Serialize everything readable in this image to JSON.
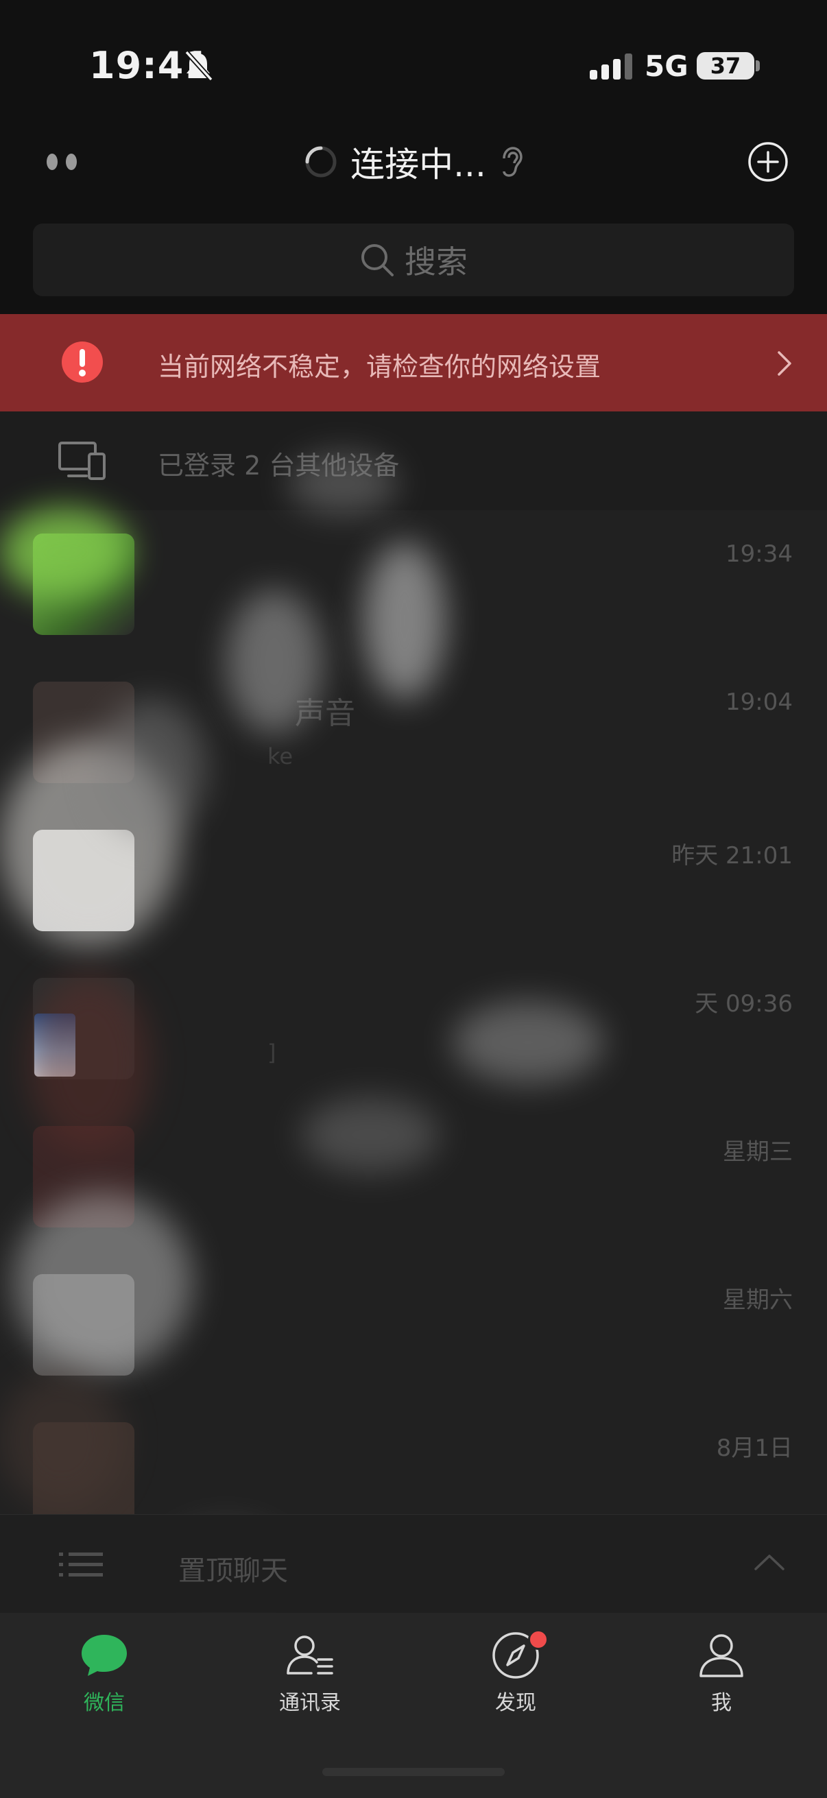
{
  "status_bar": {
    "time": "19:41",
    "network": "5G",
    "battery": "37"
  },
  "nav": {
    "title": "连接中..."
  },
  "search": {
    "placeholder": "搜索"
  },
  "alert": {
    "text": "当前网络不稳定，请检查你的网络设置",
    "color": "#862a2b"
  },
  "device": {
    "text": "已登录 2 台其他设备"
  },
  "chats": [
    {
      "time": "19:34",
      "title": "",
      "preview": ""
    },
    {
      "time": "19:04",
      "title": "声音",
      "preview": "ke"
    },
    {
      "time": "昨天 21:01",
      "title": "",
      "preview": ""
    },
    {
      "time": "天 09:36",
      "title": "",
      "preview": "]"
    },
    {
      "time": "星期三",
      "title": "",
      "preview": ""
    },
    {
      "time": "星期六",
      "title": "",
      "preview": ""
    },
    {
      "time": "8月1日",
      "title": "",
      "preview": ""
    }
  ],
  "folded": {
    "text": "置顶聊天"
  },
  "tabs": [
    {
      "label": "微信",
      "icon": "chat-bubble-icon",
      "active": true
    },
    {
      "label": "通讯录",
      "icon": "contacts-icon",
      "active": false
    },
    {
      "label": "发现",
      "icon": "compass-icon",
      "active": false
    },
    {
      "label": "我",
      "icon": "person-icon",
      "active": false
    }
  ],
  "colors": {
    "accent": "#2fb55b",
    "background": "#1f1f1f",
    "alert": "#862a2b",
    "badge": "#f04b4b"
  }
}
